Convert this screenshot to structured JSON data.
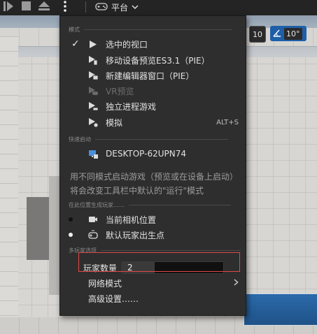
{
  "toolbar": {
    "platform_label": "平台"
  },
  "viewport": {
    "grid_value": "10",
    "angle_value": "10°"
  },
  "menu": {
    "section_mode": "模式",
    "items_mode": [
      {
        "label": "选中的视口",
        "checked": true,
        "icon": "play-icon"
      },
      {
        "label": "移动设备预览ES3.1（PIE）",
        "icon": "mobile-preview-icon"
      },
      {
        "label": "新建编辑器窗口（PIE）",
        "icon": "new-window-icon"
      },
      {
        "label": "VR预览",
        "icon": "vr-icon",
        "disabled": true
      },
      {
        "label": "独立进程游戏",
        "icon": "standalone-game-icon"
      },
      {
        "label": "模拟",
        "icon": "simulate-icon",
        "shortcut": "ALT+S"
      }
    ],
    "section_quick": "快速启动",
    "device_label": "DESKTOP-62UPN74",
    "description": "用不同模式启动游戏（预览或在设备上启动）将会改变工具栏中默认的\"运行\"模式",
    "section_spawn": "在此位置生成玩家……",
    "spawn_items": [
      {
        "label": "当前相机位置",
        "icon": "camera-icon"
      },
      {
        "label": "默认玩家出生点",
        "icon": "player-start-icon"
      }
    ],
    "section_multiplayer": "多玩家选项",
    "player_count_label": "玩家数量",
    "player_count_value": "2",
    "network_mode_label": "网络模式",
    "advanced_settings_label": "高级设置……"
  }
}
